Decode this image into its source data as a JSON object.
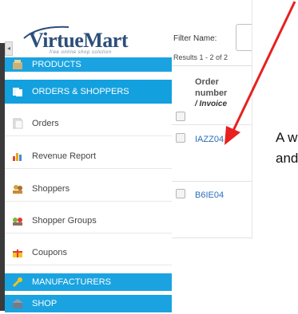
{
  "app": {
    "brand": "VirtueMart",
    "tagline": "free online shop solution"
  },
  "sidebar": {
    "collapse_glyph": "◂",
    "items": [
      {
        "label": "PRODUCTS",
        "kind": "category",
        "icon": "products-icon"
      },
      {
        "label": "ORDERS & SHOPPERS",
        "kind": "category-selected",
        "icon": "orders-shoppers-icon"
      },
      {
        "label": "Orders",
        "kind": "subitem",
        "icon": "orders-icon"
      },
      {
        "label": "Revenue Report",
        "kind": "subitem",
        "icon": "bar-chart-icon"
      },
      {
        "label": "Shoppers",
        "kind": "subitem",
        "icon": "shoppers-icon"
      },
      {
        "label": "Shopper Groups",
        "kind": "subitem",
        "icon": "shopper-groups-icon"
      },
      {
        "label": "Coupons",
        "kind": "subitem",
        "icon": "gift-icon"
      },
      {
        "label": "MANUFACTURERS",
        "kind": "category",
        "icon": "wrench-icon"
      },
      {
        "label": "SHOP",
        "kind": "category",
        "icon": "shop-icon"
      }
    ]
  },
  "main": {
    "filter_label": "Filter Name:",
    "filter_value": "",
    "results_text": "Results 1 - 2 of 2",
    "column_header": {
      "line1": "Order",
      "line2": "number",
      "line3": "/ Invoice"
    },
    "orders": [
      {
        "number": "IAZZ04"
      },
      {
        "number": "B6IE04"
      }
    ]
  },
  "annotation": {
    "line1": "A w",
    "line2": "and"
  },
  "colors": {
    "category_bg": "#1aa3e0",
    "link": "#2a6ebb",
    "arrow": "#e8201f"
  }
}
